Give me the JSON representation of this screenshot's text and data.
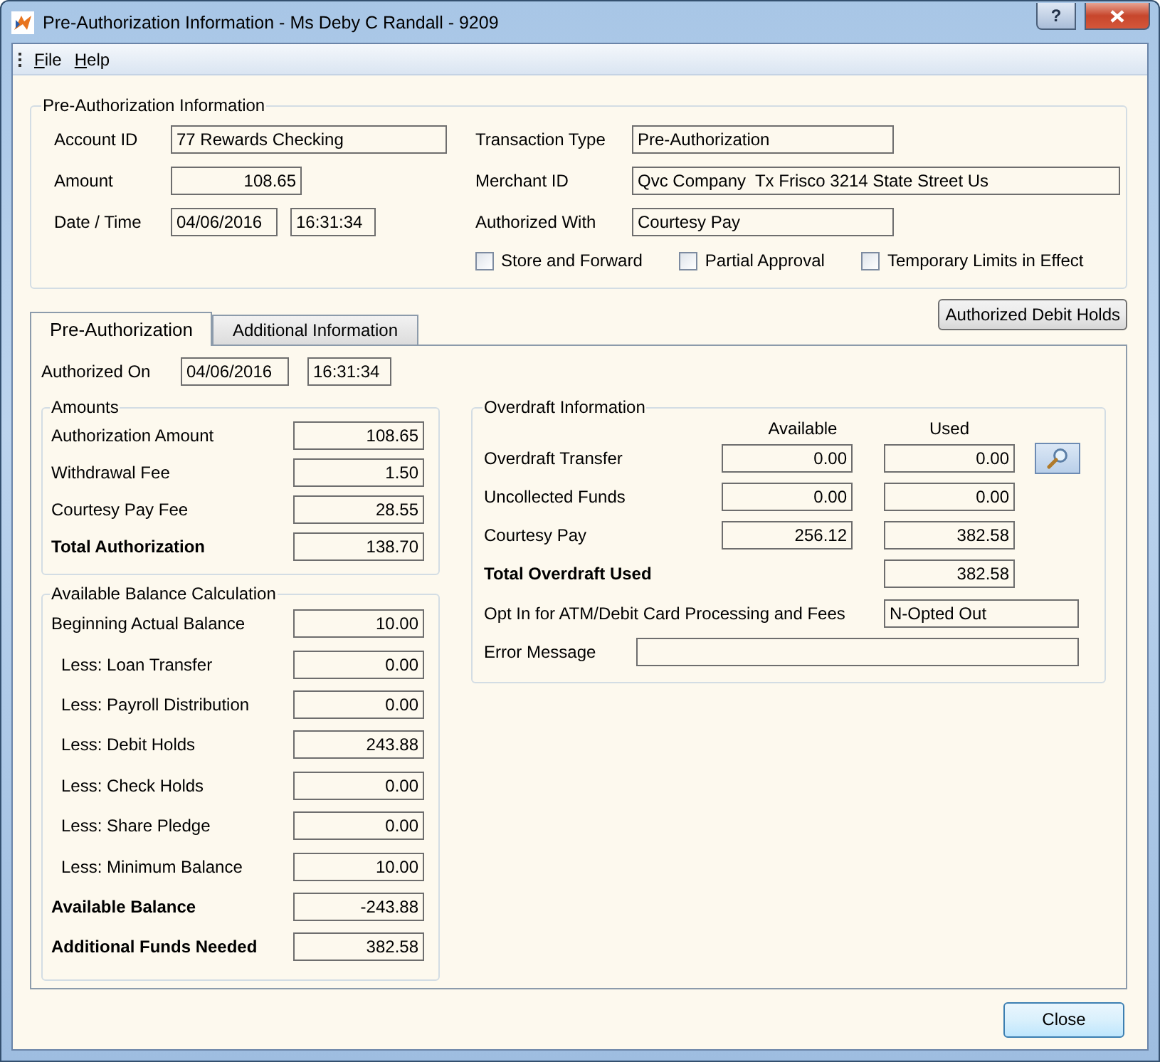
{
  "window": {
    "title": "Pre-Authorization Information - Ms Deby C Randall - 9209",
    "help": "?"
  },
  "menu": [
    {
      "label": "File"
    },
    {
      "label": "Help"
    }
  ],
  "pre_auth_info": {
    "title": "Pre-Authorization Information",
    "account_id": {
      "label": "Account ID",
      "value": "77 Rewards Checking"
    },
    "amount": {
      "label": "Amount",
      "value": "108.65"
    },
    "date_time": {
      "label": "Date / Time",
      "date": "04/06/2016",
      "time": "16:31:34"
    },
    "transaction_type": {
      "label": "Transaction Type",
      "value": "Pre-Authorization"
    },
    "merchant_id": {
      "label": "Merchant ID",
      "value": "Qvc Company  Tx Frisco 3214 State Street Us"
    },
    "authorized_with": {
      "label": "Authorized With",
      "value": "Courtesy Pay"
    },
    "options": [
      {
        "label": "Store and Forward",
        "checked": false
      },
      {
        "label": "Partial Approval",
        "checked": false
      },
      {
        "label": "Temporary Limits in Effect",
        "checked": false
      }
    ]
  },
  "tabs": [
    {
      "label": "Pre-Authorization",
      "selected": true
    },
    {
      "label": "Additional Information",
      "selected": false
    }
  ],
  "debit_holds_button": "Authorized Debit Holds",
  "authorized_on": {
    "label": "Authorized On",
    "date": "04/06/2016",
    "time": "16:31:34"
  },
  "amounts": {
    "title": "Amounts",
    "rows": [
      {
        "label": "Authorization Amount",
        "value": "108.65",
        "kind": "normal"
      },
      {
        "label": "Withdrawal Fee",
        "value": "1.50",
        "kind": "normal"
      },
      {
        "label": "Courtesy Pay Fee",
        "value": "28.55",
        "kind": "normal"
      },
      {
        "label": "Total Authorization",
        "value": "138.70",
        "kind": "total"
      }
    ]
  },
  "balance": {
    "title": "Available Balance Calculation",
    "rows": [
      {
        "label": "Beginning Actual Balance",
        "value": "10.00",
        "kind": "normal"
      },
      {
        "label": "Less: Loan Transfer",
        "value": "0.00",
        "kind": "indent"
      },
      {
        "label": "Less: Payroll Distribution",
        "value": "0.00",
        "kind": "indent"
      },
      {
        "label": "Less: Debit Holds",
        "value": "243.88",
        "kind": "indent"
      },
      {
        "label": "Less: Check Holds",
        "value": "0.00",
        "kind": "indent"
      },
      {
        "label": "Less: Share Pledge",
        "value": "0.00",
        "kind": "indent"
      },
      {
        "label": "Less: Minimum Balance",
        "value": "10.00",
        "kind": "indent"
      },
      {
        "label": "Available Balance",
        "value": "-243.88",
        "kind": "total"
      },
      {
        "label": "Additional Funds Needed",
        "value": "382.58",
        "kind": "total"
      }
    ]
  },
  "overdraft": {
    "title": "Overdraft Information",
    "columns": [
      "Available",
      "Used"
    ],
    "rows": [
      {
        "label": "Overdraft Transfer",
        "available": "0.00",
        "used": "0.00",
        "kind": "normal",
        "lookup": true
      },
      {
        "label": "Uncollected Funds",
        "available": "0.00",
        "used": "0.00",
        "kind": "normal",
        "lookup": false
      },
      {
        "label": "Courtesy Pay",
        "available": "256.12",
        "used": "382.58",
        "kind": "normal",
        "lookup": false
      },
      {
        "label": "Total Overdraft Used",
        "used": "382.58",
        "kind": "total",
        "lookup": false
      }
    ],
    "opt_in": {
      "label": "Opt In for ATM/Debit Card Processing and Fees",
      "value": "N-Opted Out"
    },
    "error": {
      "label": "Error Message"
    }
  },
  "close_button": "Close"
}
